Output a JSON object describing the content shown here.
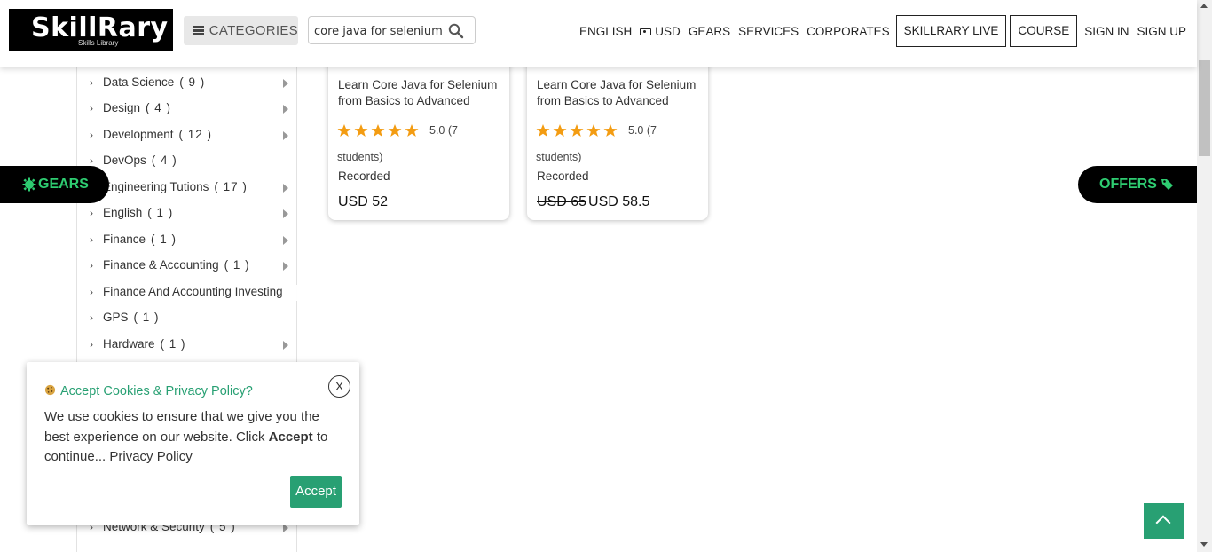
{
  "header": {
    "logo": {
      "brand": "SkillRary",
      "tagline": "Skills Library"
    },
    "categories_label": "CATEGORIES",
    "search": {
      "value": "core java for selenium",
      "placeholder": ""
    },
    "nav": {
      "english": "ENGLISH",
      "usd": "USD",
      "gears": "GEARS",
      "services": "SERVICES",
      "corporates": "CORPORATES",
      "skillrary_live": "SKILLRARY LIVE",
      "course": "COURSE",
      "sign_in": "SIGN IN",
      "sign_up": "SIGN UP"
    }
  },
  "sidebar": {
    "items": [
      {
        "label": "Data Science",
        "count": "( 9 )"
      },
      {
        "label": "Design",
        "count": "( 4 )"
      },
      {
        "label": "Development",
        "count": "( 12 )"
      },
      {
        "label": "DevOps",
        "count": "( 4 )"
      },
      {
        "label": "Engineering Tutions",
        "count": "( 17 )"
      },
      {
        "label": "English",
        "count": "( 1 )"
      },
      {
        "label": "Finance",
        "count": "( 1 )"
      },
      {
        "label": "Finance & Accounting",
        "count": "( 1 )"
      },
      {
        "label": "Finance And Accounting Investing",
        "count": ""
      },
      {
        "label": "GPS",
        "count": "( 1 )"
      },
      {
        "label": "Hardware",
        "count": "( 1 )"
      },
      {
        "label": "Network & Security",
        "count": "( 5 )"
      }
    ]
  },
  "courses": [
    {
      "title": "Learn Core Java for Selenium from Basics to Advanced",
      "rating": 5,
      "rating_text": "5.0 (7",
      "students_text": "students)",
      "mode": "Recorded",
      "old_price": "",
      "price": "USD 52"
    },
    {
      "title": "Learn Core Java for Selenium from Basics to Advanced",
      "rating": 5,
      "rating_text": "5.0 (7",
      "students_text": "students)",
      "mode": "Recorded",
      "old_price": "USD 65",
      "price": "USD 58.5"
    }
  ],
  "floating": {
    "gears_label": "GEARS",
    "offers_label": "OFFERS"
  },
  "cookie": {
    "close_label": "X",
    "title": "Accept Cookies & Privacy Policy?",
    "body_before": "We use cookies to ensure that we give you the best experience on our website. Click ",
    "body_bold": "Accept",
    "body_after": " to continue... Privacy Policy",
    "accept_label": "Accept"
  },
  "colors": {
    "accent_green": "#28a073",
    "pill_text_green": "#2ecc71",
    "star_orange": "#f39c12"
  }
}
